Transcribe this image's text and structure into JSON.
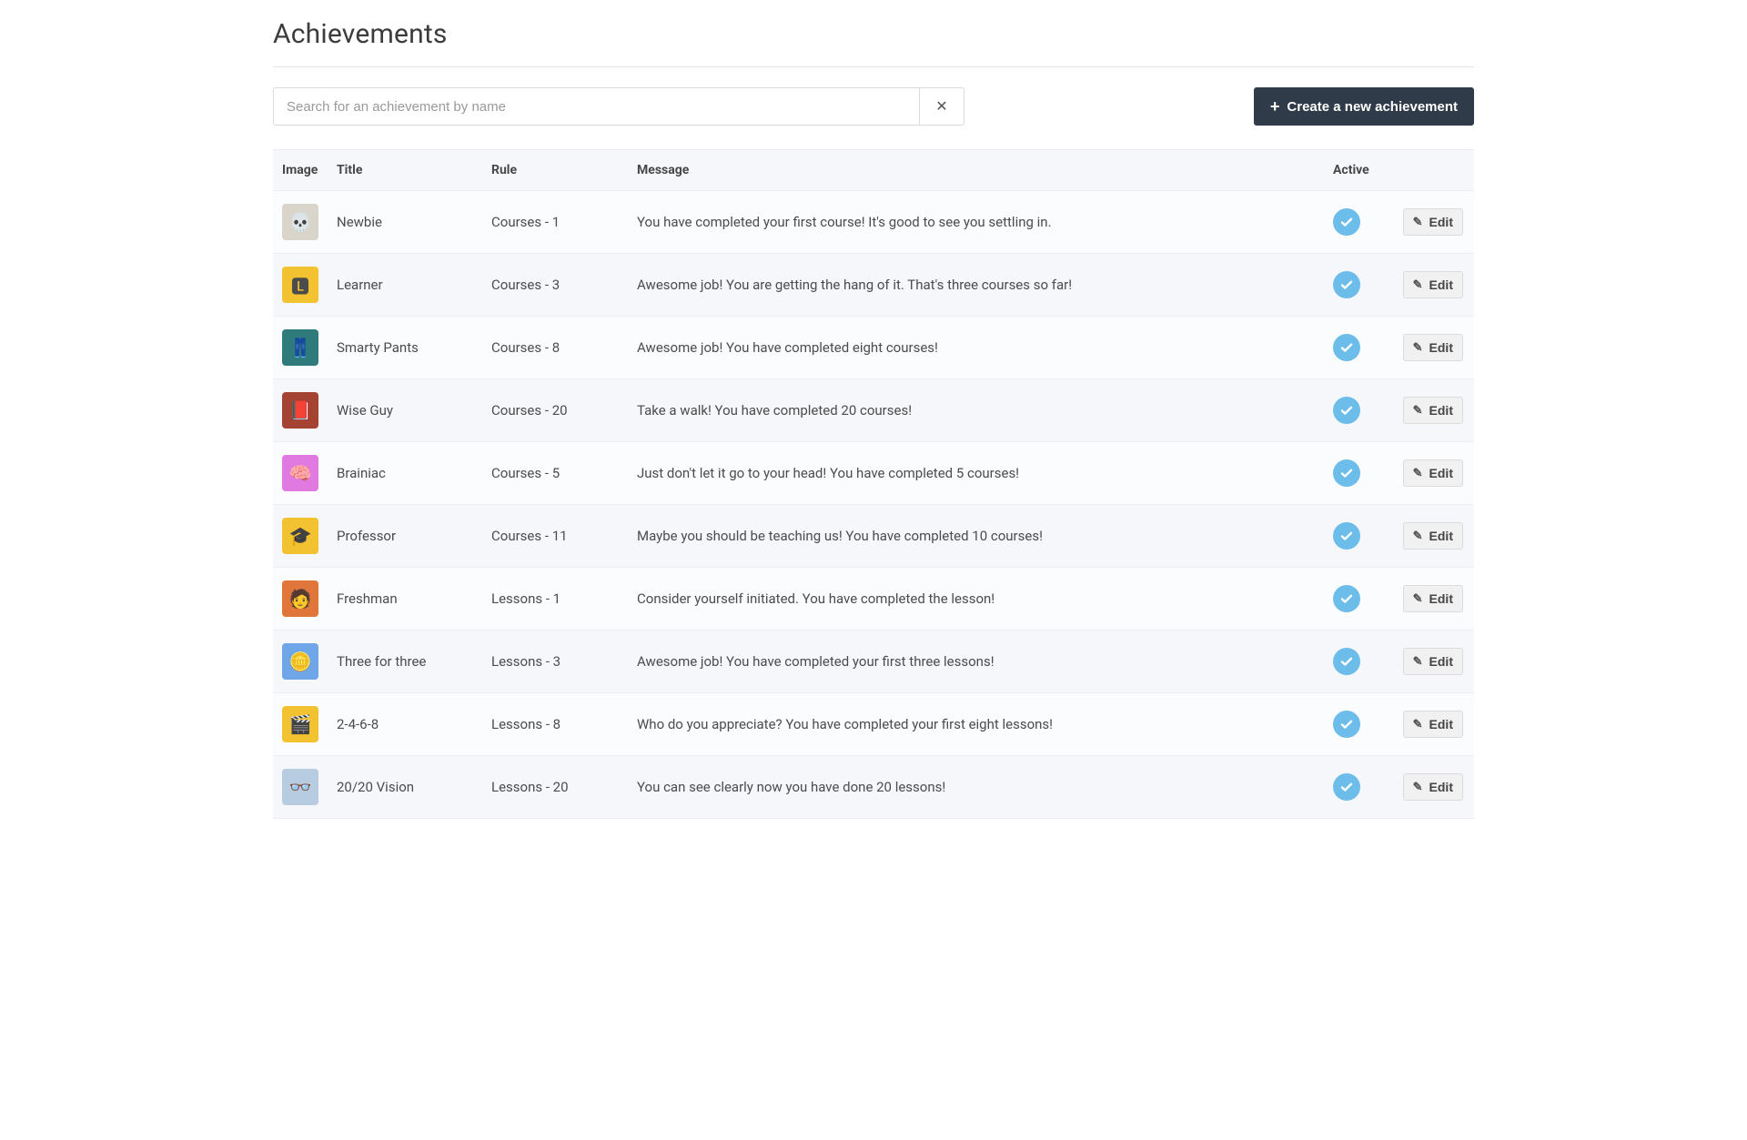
{
  "header": {
    "title": "Achievements"
  },
  "search": {
    "placeholder": "Search for an achievement by name",
    "value": "",
    "clear_icon": "✕"
  },
  "create_button": {
    "label": "Create a new achievement",
    "icon": "+"
  },
  "table": {
    "columns": {
      "image": "Image",
      "title": "Title",
      "rule": "Rule",
      "message": "Message",
      "active": "Active",
      "edit": ""
    },
    "edit_label": "Edit",
    "rows": [
      {
        "title": "Newbie",
        "rule": "Courses - 1",
        "message": "You have completed your first course! It's good to see you settling in.",
        "active": true,
        "badge_bg": "#d9d5cb",
        "badge_emoji": "💀"
      },
      {
        "title": "Learner",
        "rule": "Courses - 3",
        "message": "Awesome job! You are getting the hang of it. That's three courses so far!",
        "active": true,
        "badge_bg": "#f2c230",
        "badge_emoji": "🅻"
      },
      {
        "title": "Smarty Pants",
        "rule": "Courses - 8",
        "message": "Awesome job! You have completed eight courses!",
        "active": true,
        "badge_bg": "#2f7a7a",
        "badge_emoji": "👖"
      },
      {
        "title": "Wise Guy",
        "rule": "Courses - 20",
        "message": "Take a walk! You have completed 20 courses!",
        "active": true,
        "badge_bg": "#a44332",
        "badge_emoji": "📕"
      },
      {
        "title": "Brainiac",
        "rule": "Courses - 5",
        "message": "Just don't let it go to your head! You have completed 5 courses!",
        "active": true,
        "badge_bg": "#e07ae0",
        "badge_emoji": "🧠"
      },
      {
        "title": "Professor",
        "rule": "Courses - 11",
        "message": "Maybe you should be teaching us! You have completed 10 courses!",
        "active": true,
        "badge_bg": "#f2c230",
        "badge_emoji": "🎓"
      },
      {
        "title": "Freshman",
        "rule": "Lessons - 1",
        "message": "Consider yourself initiated. You have completed the lesson!",
        "active": true,
        "badge_bg": "#e0763a",
        "badge_emoji": "🧑"
      },
      {
        "title": "Three for three",
        "rule": "Lessons - 3",
        "message": "Awesome job! You have completed your first three lessons!",
        "active": true,
        "badge_bg": "#6ea6e8",
        "badge_emoji": "🪙"
      },
      {
        "title": "2-4-6-8",
        "rule": "Lessons - 8",
        "message": "Who do you appreciate? You have completed your first eight lessons!",
        "active": true,
        "badge_bg": "#f2c230",
        "badge_emoji": "🎬"
      },
      {
        "title": "20/20 Vision",
        "rule": "Lessons - 20",
        "message": "You can see clearly now you have done 20 lessons!",
        "active": true,
        "badge_bg": "#b7cce0",
        "badge_emoji": "👓"
      }
    ]
  }
}
